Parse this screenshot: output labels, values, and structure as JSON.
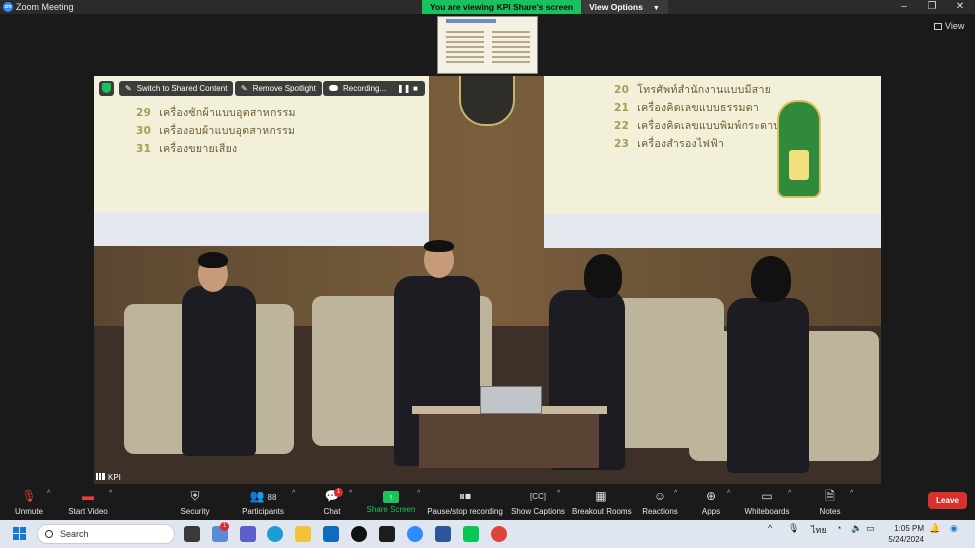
{
  "window": {
    "title": "Zoom Meeting",
    "controls": [
      "–",
      "❐",
      "✕"
    ]
  },
  "share_banner": {
    "viewing_text": "You are viewing KPI Share's screen",
    "view_options_label": "View Options"
  },
  "view_button": {
    "label": "View"
  },
  "video_overlay": {
    "switch_label": "Switch to Shared Content",
    "remove_spotlight_label": "Remove Spotlight",
    "recording_label": "Recording...",
    "participant_name": "KPI"
  },
  "slide_left": {
    "lines": [
      {
        "num": "29",
        "text": "เครื่องซักผ้าแบบอุตสาหกรรม"
      },
      {
        "num": "30",
        "text": "เครื่องอบผ้าแบบอุตสาหกรรม"
      },
      {
        "num": "31",
        "text": "เครื่องขยายเสียง"
      }
    ]
  },
  "slide_right": {
    "lines": [
      {
        "num": "20",
        "text": "โทรศัพท์สำนักงานแบบมีสาย"
      },
      {
        "num": "21",
        "text": "เครื่องคิดเลขแบบธรรมดา"
      },
      {
        "num": "22",
        "text": "เครื่องคิดเลขแบบพิมพ์กระดาษ"
      },
      {
        "num": "23",
        "text": "เครื่องสำรองไฟฟ้า"
      }
    ]
  },
  "toolbar": {
    "unmute": "Unmute",
    "start_video": "Start Video",
    "security": "Security",
    "participants": "Participants",
    "participants_count": "88",
    "chat": "Chat",
    "chat_badge": "1",
    "share_screen": "Share Screen",
    "pause_stop_recording": "Pause/stop recording",
    "show_captions": "Show Captions",
    "breakout_rooms": "Breakout Rooms",
    "reactions": "Reactions",
    "apps": "Apps",
    "whiteboards": "Whiteboards",
    "notes": "Notes",
    "leave": "Leave"
  },
  "taskbar": {
    "search_placeholder": "Search",
    "notification_badge": "1",
    "tray_lang": "ไทย",
    "time": "1:05 PM",
    "date": "5/24/2024"
  },
  "colors": {
    "accent_green": "#18c25c",
    "leave_red": "#d9302b",
    "zoom_blue": "#2d8cff"
  }
}
